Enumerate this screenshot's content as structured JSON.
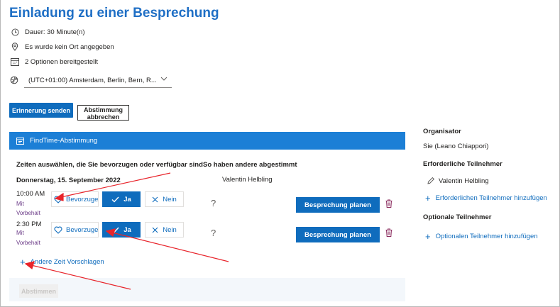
{
  "header": {
    "title": "Einladung zu einer Besprechung"
  },
  "info": {
    "duration": "Dauer: 30 Minute(n)",
    "location": "Es wurde kein Ort angegeben",
    "options": "2 Optionen bereitgestellt",
    "timezone": "(UTC+01:00) Amsterdam, Berlin, Bern, R..."
  },
  "actions": {
    "remind": "Erinnerung senden",
    "cancel_poll": "Abstimmung abbrechen"
  },
  "findtime": {
    "header": "FindTime-Abstimmung",
    "col_select": "Zeiten auswählen, die Sie bevorzugen oder verfügbar sind",
    "col_others": "So haben andere abgestimmt",
    "date": "Donnerstag, 15. September 2022",
    "voter": "Valentin Helbling",
    "slots": [
      {
        "time": "10:00 AM",
        "sub1": "Mit",
        "sub2": "Vorbehalt",
        "prefer": "Bevorzugen",
        "yes": "Ja",
        "no": "Nein",
        "vote": "?",
        "plan": "Besprechung planen"
      },
      {
        "time": "2:30 PM",
        "sub1": "Mit",
        "sub2": "Vorbehalt",
        "prefer": "Bevorzugen",
        "yes": "Ja",
        "no": "Nein",
        "vote": "?",
        "plan": "Besprechung planen"
      }
    ],
    "suggest": "Andere Zeit Vorschlagen",
    "submit": "Abstimmen"
  },
  "sidebar": {
    "organizer_label": "Organisator",
    "organizer": "Sie (Leano Chiappori)",
    "required_label": "Erforderliche Teilnehmer",
    "required_person": "Valentin Helbling",
    "add_required": "Erforderlichen Teilnehmer hinzufügen",
    "optional_label": "Optionale Teilnehmer",
    "add_optional": "Optionalen Teilnehmer hinzufügen"
  },
  "colors": {
    "accent": "#0f6cbd",
    "header_bar": "#1c7fd6",
    "title": "#1f6fc5",
    "annotation": "#e8242b"
  }
}
